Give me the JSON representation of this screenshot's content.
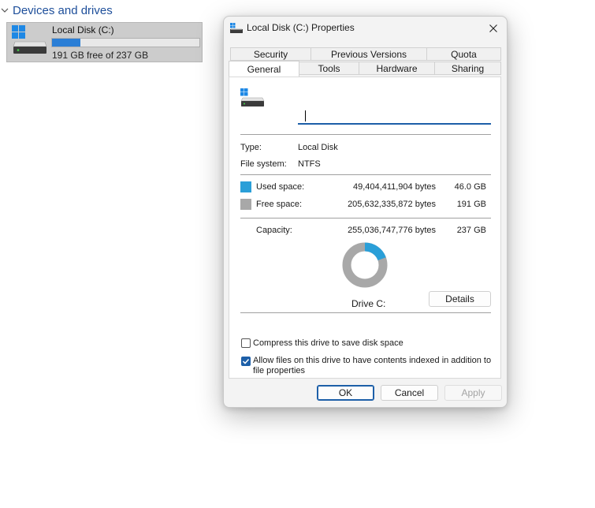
{
  "explorer": {
    "section_title": "Devices and drives",
    "drive": {
      "name": "Local Disk (C:)",
      "free_text": "191 GB free of 237 GB",
      "used_fraction": 0.194
    }
  },
  "dialog": {
    "title": "Local Disk (C:) Properties",
    "tabs_top": [
      "Security",
      "Previous Versions",
      "Quota"
    ],
    "tabs_bottom": [
      "General",
      "Tools",
      "Hardware",
      "Sharing"
    ],
    "active_tab": "General",
    "name_value": "",
    "type_label": "Type:",
    "type_value": "Local Disk",
    "fs_label": "File system:",
    "fs_value": "NTFS",
    "used": {
      "label": "Used space:",
      "bytes": "49,404,411,904 bytes",
      "size": "46.0 GB",
      "color": "#2a9fd8"
    },
    "free": {
      "label": "Free space:",
      "bytes": "205,632,335,872 bytes",
      "size": "191 GB",
      "color": "#a8a8a8"
    },
    "capacity": {
      "label": "Capacity:",
      "bytes": "255,036,747,776 bytes",
      "size": "237 GB"
    },
    "used_fraction": 0.194,
    "drive_label": "Drive C:",
    "details_button": "Details",
    "compress_label": "Compress this drive to save disk space",
    "compress_checked": false,
    "index_label_line1": "Allow files on this drive to have contents indexed in addition to",
    "index_label_line2": "file properties",
    "index_checked": true,
    "ok_button": "OK",
    "cancel_button": "Cancel",
    "apply_button": "Apply"
  },
  "icons": {
    "windows_logo": "windows-logo-icon",
    "drive": "hard-drive-icon",
    "close": "close-icon",
    "chevron": "chevron-down-icon",
    "check": "checkmark-icon"
  }
}
